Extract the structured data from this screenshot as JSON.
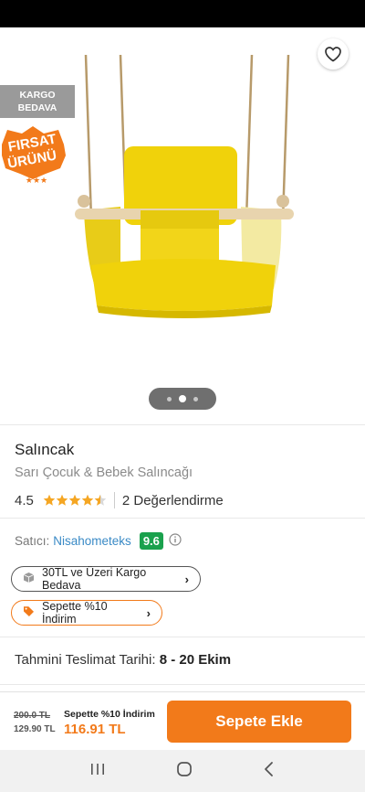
{
  "badges": {
    "cargo_line1": "KARGO",
    "cargo_line2": "BEDAVA",
    "firsat_line1": "FIRSAT",
    "firsat_line2": "ÜRÜNÜ"
  },
  "product": {
    "title": "Salıncak",
    "subtitle": "Sarı Çocuk & Bebek Salıncağı",
    "rating": "4.5",
    "rating_value": 4.5,
    "reviews": "2 Değerlendirme"
  },
  "gallery": {
    "image_count": 3,
    "active_index": 1
  },
  "seller": {
    "label": "Satıcı:",
    "name": "Nisahometeks",
    "score": "9.6"
  },
  "promos": {
    "cargo": "30TL ve Üzeri Kargo Bedava",
    "discount": "Sepette %10 İndirim"
  },
  "delivery": {
    "label": "Tahmini Teslimat Tarihi:",
    "date": "8 - 20 Ekim"
  },
  "pricing": {
    "original": "200.0 TL",
    "current": "129.90 TL",
    "discount_label": "Sepette %10 İndirim",
    "final": "116.91 TL"
  },
  "actions": {
    "add_to_cart": "Sepete Ekle"
  },
  "colors": {
    "accent": "#f27a1a",
    "seller_link": "#3a8ac6",
    "score_badge": "#1aa14d"
  }
}
